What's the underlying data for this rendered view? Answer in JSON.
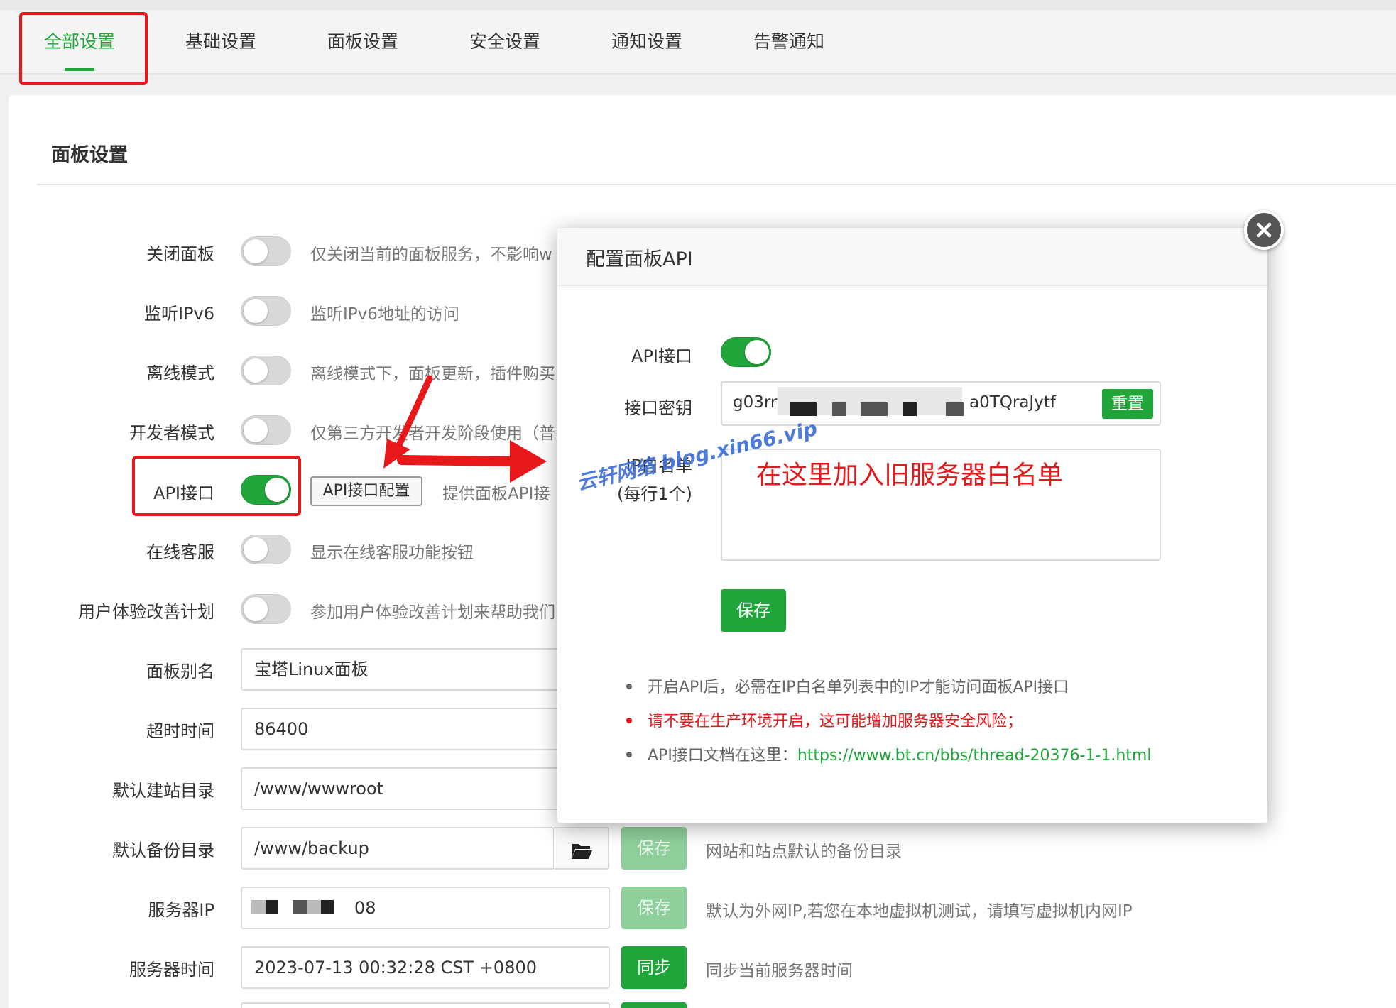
{
  "tabs": [
    {
      "label": "全部设置",
      "active": true
    },
    {
      "label": "基础设置",
      "active": false
    },
    {
      "label": "面板设置",
      "active": false
    },
    {
      "label": "安全设置",
      "active": false
    },
    {
      "label": "通知设置",
      "active": false
    },
    {
      "label": "告警通知",
      "active": false
    }
  ],
  "section": {
    "title": "面板设置"
  },
  "toggle_rows": [
    {
      "label": "关闭面板",
      "on": false,
      "desc": "仅关闭当前的面板服务，不影响w"
    },
    {
      "label": "监听IPv6",
      "on": false,
      "desc": "监听IPv6地址的访问"
    },
    {
      "label": "离线模式",
      "on": false,
      "desc": "离线模式下，面板更新，插件购买"
    },
    {
      "label": "开发者模式",
      "on": false,
      "desc": "仅第三方开发者开发阶段使用（普"
    },
    {
      "label": "API接口",
      "on": true,
      "desc": "提供面板API接"
    },
    {
      "label": "在线客服",
      "on": false,
      "desc": "显示在线客服功能按钮"
    },
    {
      "label": "用户体验改善计划",
      "on": false,
      "desc": "参加用户体验改善计划来帮助我们"
    }
  ],
  "api_config_button": "API接口配置",
  "input_rows": [
    {
      "label": "面板别名",
      "value": "宝塔Linux面板"
    },
    {
      "label": "超时时间",
      "value": "86400"
    },
    {
      "label": "默认建站目录",
      "value": "/www/wwwroot"
    },
    {
      "label": "默认备份目录",
      "value": "/www/backup",
      "button": "保存",
      "desc": "网站和站点默认的备份目录"
    },
    {
      "label": "服务器IP",
      "value": "08",
      "button": "保存",
      "desc": "默认为外网IP,若您在本地虚拟机测试，请填写虚拟机内网IP"
    },
    {
      "label": "服务器时间",
      "value": "2023-07-13 00:32:28 CST +0800",
      "button": "同步",
      "desc": "同步当前服务器时间"
    }
  ],
  "modal": {
    "title": "配置面板API",
    "api_label": "API接口",
    "api_enabled": true,
    "key_label": "接口密钥",
    "key_prefix": "g03rr",
    "key_suffix": "a0TQraJytf",
    "reset_label": "重置",
    "whitelist_label": "IP白名单",
    "whitelist_hint": "(每行1个)",
    "save_label": "保存",
    "tips": [
      {
        "text": "开启API后，必需在IP白名单列表中的IP才能访问面板API接口",
        "warn": false
      },
      {
        "text": "请不要在生产环境开启，这可能增加服务器安全风险；",
        "warn": true
      },
      {
        "text": "API接口文档在这里：",
        "warn": false,
        "link": "https://www.bt.cn/bbs/thread-20376-1-1.html"
      }
    ]
  },
  "annotation": "在这里加入旧服务器白名单",
  "watermark": "云轩网络 blog.xin66.vip",
  "colors": {
    "accent": "#20a53a",
    "highlight": "#e8181a",
    "watermark": "#3a6cd8"
  }
}
